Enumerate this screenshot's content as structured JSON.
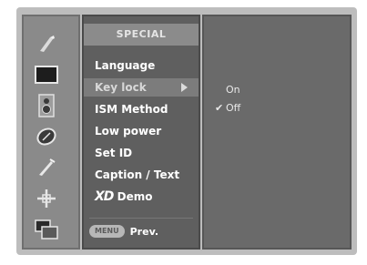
{
  "icons": [
    {
      "name": "picture-icon"
    },
    {
      "name": "screen-icon"
    },
    {
      "name": "sound-icon"
    },
    {
      "name": "time-icon"
    },
    {
      "name": "special-icon"
    },
    {
      "name": "setup-icon"
    },
    {
      "name": "pip-icon"
    }
  ],
  "menu": {
    "title": "SPECIAL",
    "items": [
      {
        "label": "Language"
      },
      {
        "label": "Key lock"
      },
      {
        "label": "ISM Method"
      },
      {
        "label": "Low power"
      },
      {
        "label": "Set ID"
      },
      {
        "label": "Caption / Text"
      }
    ],
    "xd_demo": {
      "logo": "XD",
      "label": "Demo"
    },
    "selected_index": 1
  },
  "footer": {
    "menu_button": "MENU",
    "prev_label": "Prev."
  },
  "submenu": {
    "options": [
      {
        "label": "On",
        "checked": false
      },
      {
        "label": "Off",
        "checked": true
      }
    ],
    "check_glyph": "✔"
  },
  "colors": {
    "rail": "#8a8a8a",
    "menu": "#5f5f5f",
    "selected": "#7c7c7c",
    "submenu": "#6a6a6a"
  }
}
